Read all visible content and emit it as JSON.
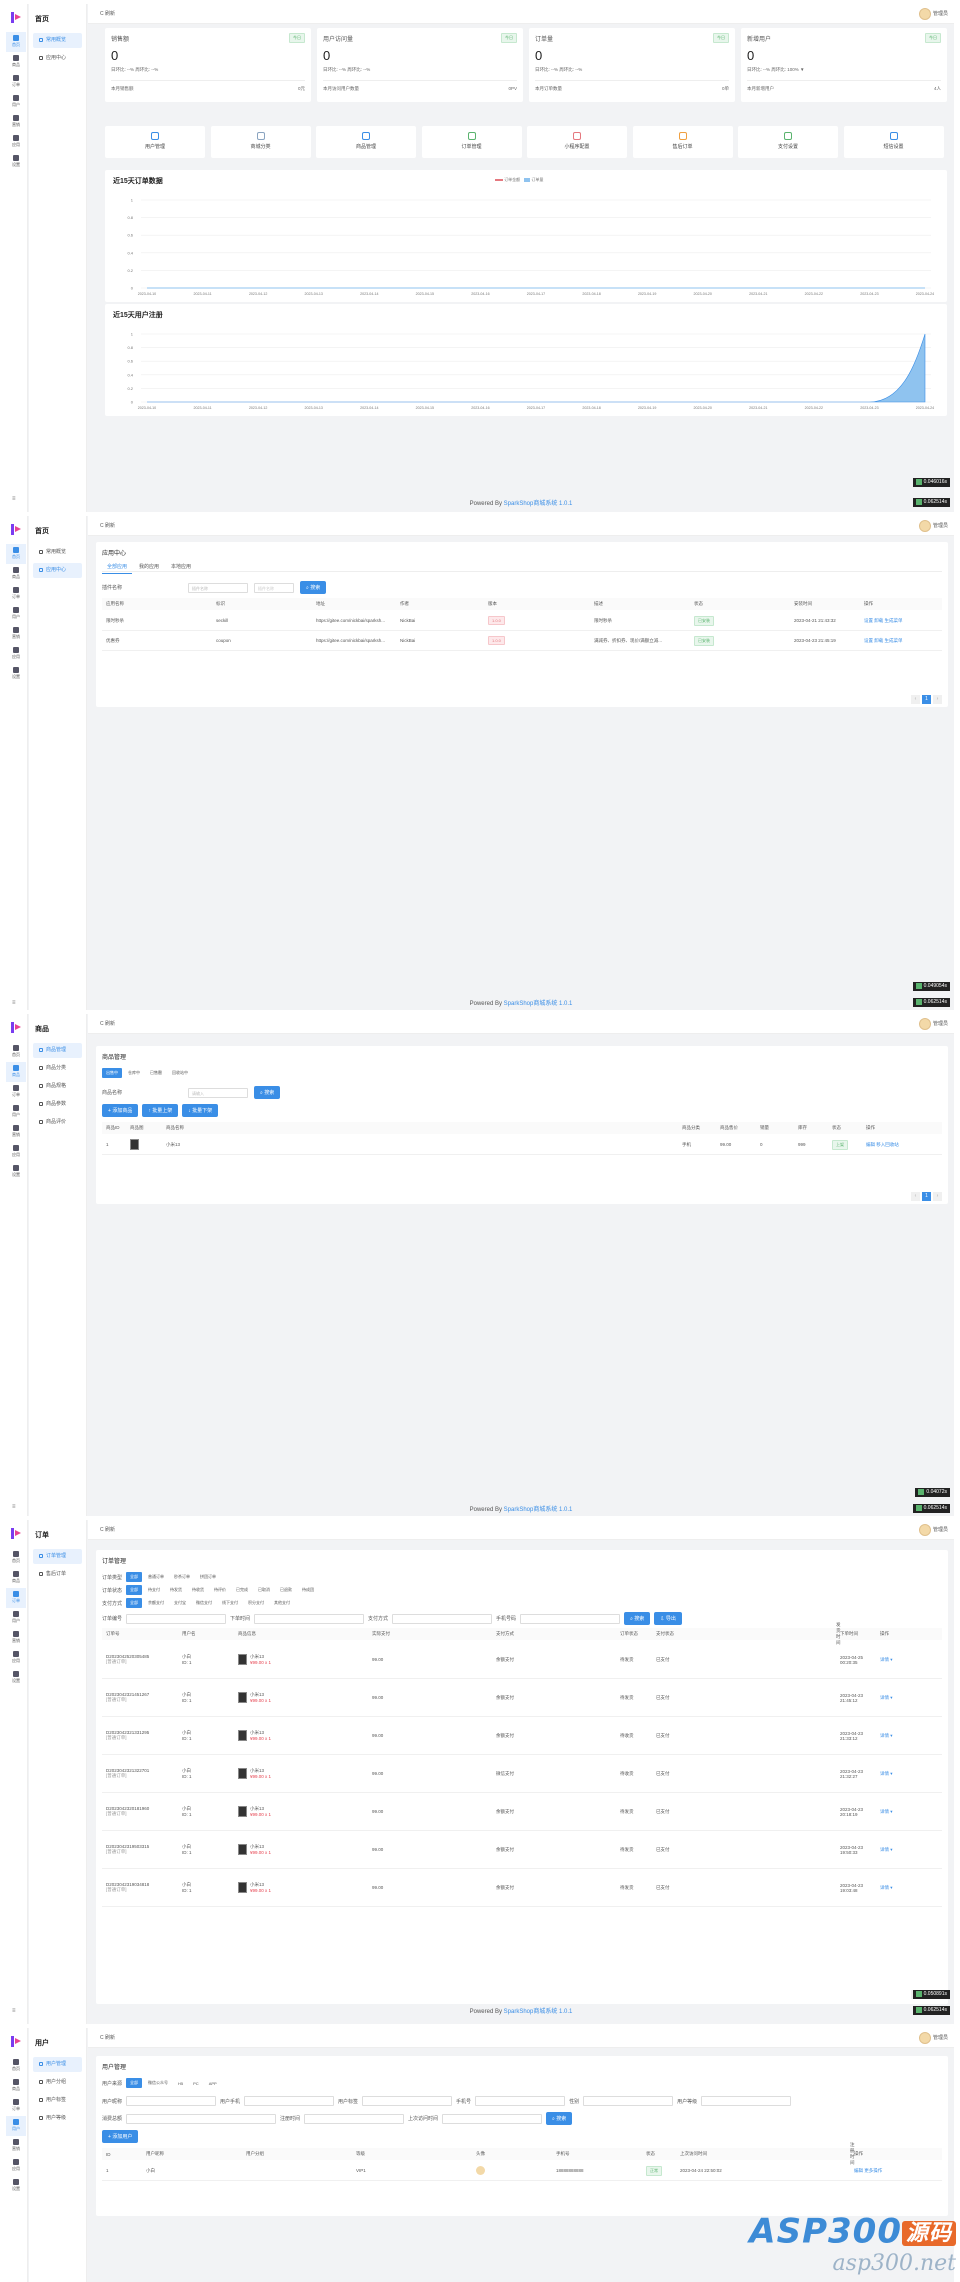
{
  "footer": {
    "prefix": "Powered By",
    "link": "SparkShop商城系统 1.0.1"
  },
  "topbar": {
    "refresh": "C 刷新",
    "user": "管理员"
  },
  "sidebar": {
    "items": [
      "首页",
      "商品",
      "订单",
      "用户",
      "营销",
      "应用",
      "设置"
    ]
  },
  "p1": {
    "title": "首页",
    "menu": [
      "常用概览",
      "应用中心"
    ],
    "stats": [
      {
        "title": "销售额",
        "tag": "今日",
        "value": "0",
        "sub": "日环比: --% 周环比: --%",
        "foot_l": "本月销售额",
        "foot_r": "0元"
      },
      {
        "title": "用户访问量",
        "tag": "今日",
        "value": "0",
        "sub": "日环比: --% 周环比: --%",
        "foot_l": "本月访问用户数量",
        "foot_r": "0PV"
      },
      {
        "title": "订单量",
        "tag": "今日",
        "value": "0",
        "sub": "日环比: --% 周环比: --%",
        "foot_l": "本月订单数量",
        "foot_r": "0单"
      },
      {
        "title": "新增用户",
        "tag": "今日",
        "value": "0",
        "sub": "日环比: --% 周环比: 100% ▼",
        "foot_l": "本月新增用户",
        "foot_r": "4人"
      }
    ],
    "quick": [
      "用户管理",
      "商城分类",
      "商品管理",
      "订单管理",
      "小程序配置",
      "售后订单",
      "支付设置",
      "短信设置"
    ],
    "chart1_title": "近15天订单数据",
    "chart2_title": "近15天用户注册",
    "timer": "0.046016s",
    "timer2": "0.062514s"
  },
  "chart_data": [
    {
      "type": "line",
      "title": "近15天订单数据",
      "legend": [
        "订单金额",
        "订单量"
      ],
      "categories": [
        "2023-04-10",
        "2023-04-11",
        "2023-04-12",
        "2023-04-13",
        "2023-04-14",
        "2023-04-15",
        "2023-04-16",
        "2023-04-17",
        "2023-04-18",
        "2023-04-19",
        "2023-04-20",
        "2023-04-21",
        "2023-04-22",
        "2023-04-23",
        "2023-04-24"
      ],
      "series": [
        {
          "name": "订单金额",
          "values": [
            0,
            0,
            0,
            0,
            0,
            0,
            0,
            0,
            0,
            0,
            0,
            0,
            0,
            0,
            0
          ]
        },
        {
          "name": "订单量",
          "values": [
            0,
            0,
            0,
            0,
            0,
            0,
            0,
            0,
            0,
            0,
            0,
            0,
            0,
            0,
            0
          ]
        }
      ],
      "yticks": [
        "1",
        "0.8",
        "0.6",
        "0.4",
        "0.2",
        "0"
      ],
      "ylim": [
        0,
        1
      ]
    },
    {
      "type": "area",
      "title": "近15天用户注册",
      "categories": [
        "2023-04-10",
        "2023-04-11",
        "2023-04-12",
        "2023-04-13",
        "2023-04-14",
        "2023-04-15",
        "2023-04-16",
        "2023-04-17",
        "2023-04-18",
        "2023-04-19",
        "2023-04-20",
        "2023-04-21",
        "2023-04-22",
        "2023-04-23",
        "2023-04-24"
      ],
      "series": [
        {
          "values": [
            0,
            0,
            0,
            0,
            0,
            0,
            0,
            0,
            0,
            0,
            0,
            0,
            0,
            0,
            1
          ]
        }
      ],
      "yticks": [
        "1",
        "0.8",
        "0.6",
        "0.4",
        "0.2",
        "0"
      ],
      "ylim": [
        0,
        1
      ]
    }
  ],
  "p2": {
    "title": "首页",
    "menu": [
      "常用概览",
      "应用中心"
    ],
    "card_title": "应用中心",
    "tabs": [
      "全部应用",
      "我的应用",
      "本地应用"
    ],
    "filter_label": "插件名称",
    "filter_ph": "插件名称",
    "search": "搜索",
    "headers": [
      "应用名称",
      "标识",
      "地址",
      "作者",
      "版本",
      "描述",
      "状态",
      "安装时间",
      "操作"
    ],
    "rows": [
      {
        "name": "限时秒杀",
        "key": "seckill",
        "url": "https://gitee.com/nickbai/sparksh...",
        "author": "NickBai",
        "ver": "1.0.0",
        "desc": "限时秒杀",
        "status": "已安装",
        "time": "2023-04-21 21:43:32",
        "ops": "设置 卸载 生成菜单"
      },
      {
        "name": "优惠券",
        "key": "coupon",
        "url": "https://gitee.com/nickbai/sparksh...",
        "author": "NickBai",
        "ver": "1.0.0",
        "desc": "满减券、折扣券、现价/满额立减...",
        "status": "已安装",
        "time": "2023-04-23 21:45:19",
        "ops": "设置 卸载 生成菜单"
      }
    ],
    "page": "1",
    "timer": "0.049054s",
    "timer2": "0.062514s"
  },
  "p3": {
    "title": "商品",
    "menu": [
      "商品管理",
      "商品分类",
      "商品规格",
      "商品参数",
      "商品评价"
    ],
    "card_title": "商品管理",
    "tabs": [
      "出售中",
      "仓库中",
      "已售罄",
      "回收站中"
    ],
    "filter_label": "商品名称",
    "filter_ph": "请输入",
    "search": "搜索",
    "actions": [
      "添加商品",
      "批量上架",
      "批量下架"
    ],
    "headers": [
      "商品ID",
      "商品图",
      "商品名称",
      "商品分类",
      "商品售价",
      "销量",
      "库存",
      "状态",
      "操作"
    ],
    "rows": [
      {
        "id": "1",
        "name": "小米13",
        "cat": "手机",
        "price": "99.00",
        "sales": "0",
        "stock": "999",
        "status": "上架",
        "ops": "编辑 移入回收站"
      }
    ],
    "page": "1",
    "timer": "0.04072s",
    "timer2": "0.062514s"
  },
  "p4": {
    "title": "订单",
    "menu": [
      "订单管理",
      "售后订单"
    ],
    "card_title": "订单管理",
    "type_label": "订单类型",
    "types": [
      "全部",
      "普通订单",
      "秒杀订单",
      "拼团订单"
    ],
    "status_label": "订单状态",
    "statuses": [
      "全部",
      "待支付",
      "待发货",
      "待收货",
      "待评价",
      "已完成",
      "已取消",
      "已退款",
      "待成团"
    ],
    "pay_label": "支付方式",
    "pays": [
      "全部",
      "余额支付",
      "支付宝",
      "微信支付",
      "线下支付",
      "积分支付",
      "其他支付"
    ],
    "fields": [
      "订单编号",
      "下单时间",
      "支付方式",
      "手机号码"
    ],
    "search": "搜索",
    "export": "导出",
    "headers": [
      "订单号",
      "用户名",
      "商品信息",
      "实际支付",
      "支付方式",
      "订单状态",
      "支付状态",
      "发货时间",
      "下单时间",
      "操作"
    ],
    "rows": [
      {
        "no": "D2023042520305485",
        "name": "小白",
        "goods": "小米13",
        "price": "¥99.00",
        "pay": "余额支付",
        "ost": "待发货",
        "pst": "已支付",
        "time": "2023-04-25 00:20:35"
      },
      {
        "no": "D2023042321451267",
        "name": "小白",
        "goods": "小米13",
        "price": "¥99.00",
        "pay": "余额支付",
        "ost": "待发货",
        "pst": "已支付",
        "time": "2023-04-23 21:45:12"
      },
      {
        "no": "D2023042321331295",
        "name": "小白",
        "goods": "小米13",
        "price": "¥99.00",
        "pay": "余额支付",
        "ost": "待收货",
        "pst": "已支付",
        "time": "2023-04-23 21:33:12"
      },
      {
        "no": "D2023042321322701",
        "name": "小白",
        "goods": "小米13",
        "price": "¥99.00",
        "pay": "微信支付",
        "ost": "待收货",
        "pst": "已支付",
        "time": "2023-04-23 21:32:27"
      },
      {
        "no": "D2023042320181960",
        "name": "小白",
        "goods": "小米13",
        "price": "¥99.00",
        "pay": "余额支付",
        "ost": "待发货",
        "pst": "已支付",
        "time": "2023-04-23 20:18:19"
      },
      {
        "no": "D2023042319503315",
        "name": "小白",
        "goods": "小米13",
        "price": "¥99.00",
        "pay": "余额支付",
        "ost": "待发货",
        "pst": "已支付",
        "time": "2023-04-23 19:50:33"
      },
      {
        "no": "D2023042319034818",
        "name": "小白",
        "goods": "小米13",
        "price": "¥99.00",
        "pay": "余额支付",
        "ost": "待发货",
        "pst": "已支付",
        "time": "2023-04-23 19:03:48"
      }
    ],
    "page": "1",
    "timer": "0.050891s",
    "timer2": "0.062514s"
  },
  "p5": {
    "title": "用户",
    "menu": [
      "用户管理",
      "用户分组",
      "用户标签",
      "用户等级"
    ],
    "card_title": "用户管理",
    "src_label": "用户来源",
    "srcs": [
      "全部",
      "微信公众号",
      "H5",
      "PC",
      "APP"
    ],
    "fields1": [
      "用户昵称",
      "用户手机",
      "用户标签",
      "手机号",
      "性别",
      "用户等级"
    ],
    "fields2": [
      "消费总额",
      "注册时间",
      "上次访问时间"
    ],
    "search": "搜索",
    "add": "添加用户",
    "headers": [
      "ID",
      "用户昵称",
      "用户分组",
      "等级",
      "头像",
      "手机号",
      "状态",
      "上次访问时间",
      "注册时间",
      "操作"
    ],
    "rows": [
      {
        "id": "1",
        "nick": "小白",
        "group": "",
        "level": "VIP1",
        "phone": "18888888888",
        "status": "正常",
        "time": "2023-04-24 22:50:02",
        "ops": "编辑 更多操作"
      }
    ]
  },
  "watermark": {
    "a": "ASP300",
    "b": "源码",
    "c": "asp300.net"
  }
}
